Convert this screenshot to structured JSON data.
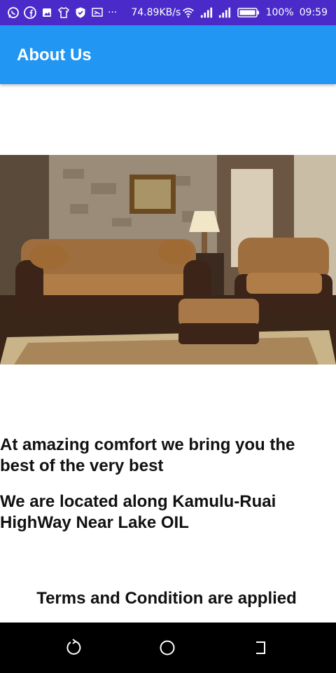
{
  "status_bar": {
    "left_icons": [
      "whatsapp-icon",
      "facebook-icon",
      "photo-icon",
      "shirt-icon",
      "shield-icon",
      "cast-icon"
    ],
    "overflow": "···",
    "speed": "74.89KB/s",
    "battery": "100%",
    "time": "09:59"
  },
  "app_bar": {
    "title": "About Us"
  },
  "content": {
    "paragraph1": "At amazing comfort we bring you the best of the very best",
    "paragraph2": "We are located along Kamulu-Ruai HighWay Near Lake OIL",
    "terms": "Terms and Condition are applied"
  },
  "colors": {
    "status_bar": "#4a2bc9",
    "app_bar": "#2196f3"
  }
}
